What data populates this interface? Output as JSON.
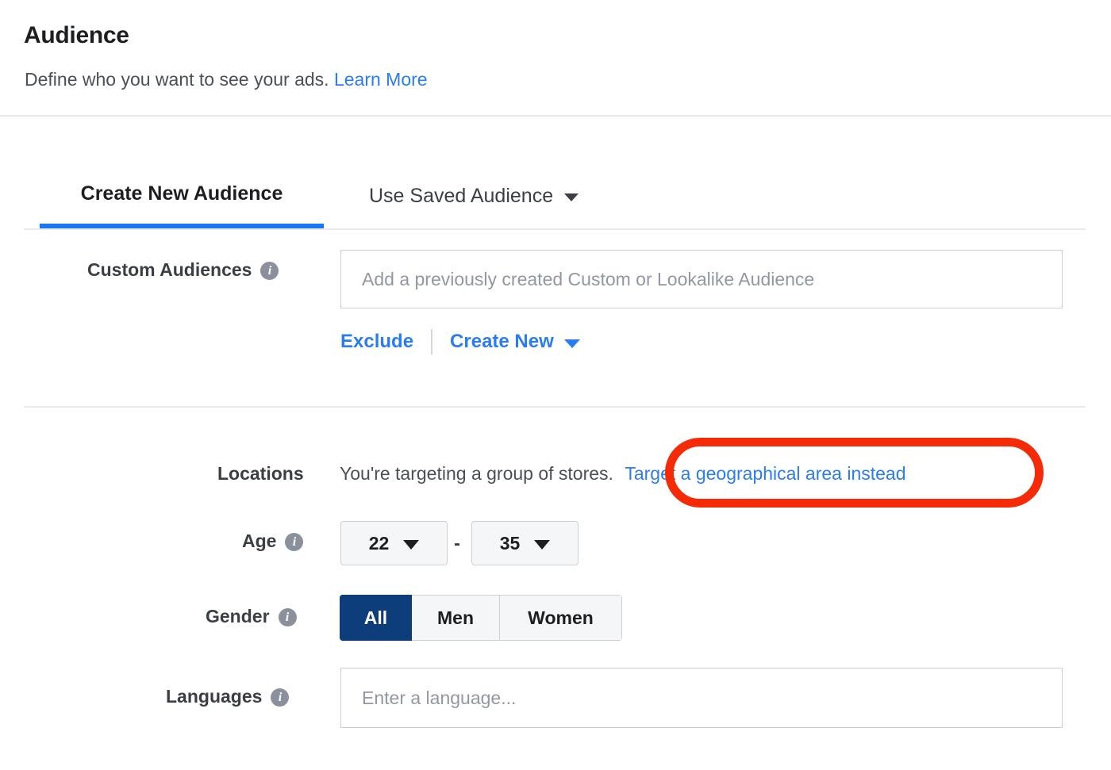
{
  "header": {
    "title": "Audience",
    "subtitle_text": "Define who you want to see your ads.",
    "learn_more_label": "Learn More"
  },
  "tabs": [
    {
      "label": "Create New Audience",
      "selected": true
    },
    {
      "label": "Use Saved Audience",
      "selected": false,
      "caret": "chevron-down-icon"
    }
  ],
  "custom_audiences": {
    "label": "Custom Audiences",
    "info_icon": "info-icon",
    "placeholder": "Add a previously created Custom or Lookalike Audience",
    "value": "",
    "exclude_label": "Exclude",
    "create_new_label": "Create New"
  },
  "locations": {
    "label": "Locations",
    "description": "You're targeting a group of stores.",
    "link_label": "Target a geographical area instead"
  },
  "age": {
    "label": "Age",
    "info_icon": "info-icon",
    "min": "22",
    "max": "35",
    "separator": "-"
  },
  "gender": {
    "label": "Gender",
    "info_icon": "info-icon",
    "options": [
      {
        "label": "All",
        "selected": true
      },
      {
        "label": "Men",
        "selected": false
      },
      {
        "label": "Women",
        "selected": false
      }
    ]
  },
  "languages": {
    "label": "Languages",
    "info_icon": "info-icon",
    "placeholder": "Enter a language...",
    "value": ""
  },
  "annotation": {
    "shape": "oval-highlight",
    "color": "#f52b08",
    "targets": "locations.link_label"
  },
  "colors": {
    "link_blue": "#2a7cf1",
    "tab_underline": "#1877f2",
    "gender_selected": "#0e3d7c",
    "annotation_red": "#f52b08",
    "border_gray": "#ccd0d5",
    "divider_gray": "#e8e9ec"
  }
}
